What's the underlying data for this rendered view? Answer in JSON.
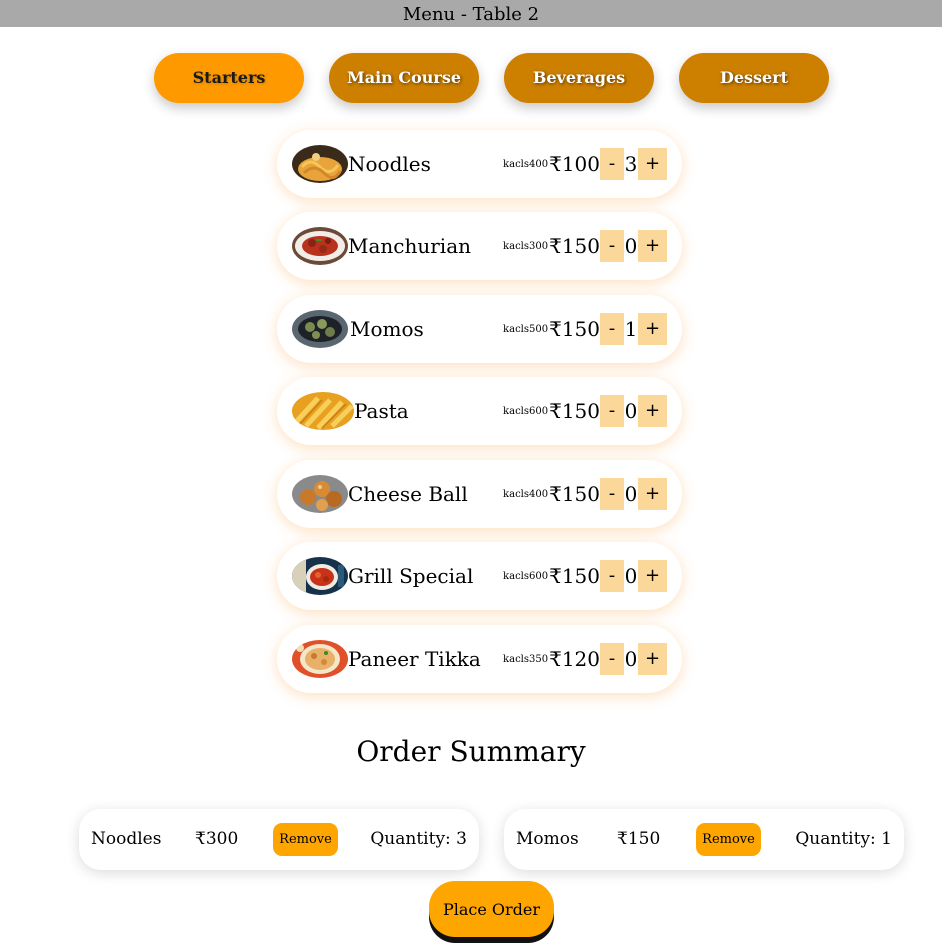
{
  "header": {
    "title": "Menu - Table 2"
  },
  "colors": {
    "header_bg": "#a9a9a9",
    "tab_active": "#ff9900",
    "tab_inactive": "#cd7f00",
    "qty_button": "#fbd89a",
    "remove_button": "#ffa500",
    "place_order": "#ffa500"
  },
  "tabs": [
    {
      "label": "Starters",
      "active": true
    },
    {
      "label": "Main Course",
      "active": false
    },
    {
      "label": "Beverages",
      "active": false
    },
    {
      "label": "Dessert",
      "active": false
    }
  ],
  "menu": {
    "items": [
      {
        "name": "Noodles",
        "kcal": "kacls400",
        "price": "₹100",
        "qty": "3",
        "image_icon": "noodles-photo"
      },
      {
        "name": "Manchurian",
        "kcal": "kacls300",
        "price": "₹150",
        "qty": "0",
        "image_icon": "manchurian-photo"
      },
      {
        "name": "Momos",
        "kcal": "kacls500",
        "price": "₹150",
        "qty": "1",
        "image_icon": "momos-photo"
      },
      {
        "name": "Pasta",
        "kcal": "kacls600",
        "price": "₹150",
        "qty": "0",
        "image_icon": "pasta-photo"
      },
      {
        "name": "Cheese Ball",
        "kcal": "kacls400",
        "price": "₹150",
        "qty": "0",
        "image_icon": "cheese-ball-photo"
      },
      {
        "name": "Grill Special",
        "kcal": "kacls600",
        "price": "₹150",
        "qty": "0",
        "image_icon": "grill-special-photo"
      },
      {
        "name": "Paneer Tikka",
        "kcal": "kacls350",
        "price": "₹120",
        "qty": "0",
        "image_icon": "paneer-tikka-photo"
      }
    ],
    "minus_label": "-",
    "plus_label": "+"
  },
  "summary": {
    "title": "Order Summary",
    "orders": [
      {
        "name": "Noodles",
        "price": "₹300",
        "remove_label": "Remove",
        "quantity": "Quantity: 3"
      },
      {
        "name": "Momos",
        "price": "₹150",
        "remove_label": "Remove",
        "quantity": "Quantity: 1"
      }
    ],
    "place_order_label": "Place Order"
  }
}
